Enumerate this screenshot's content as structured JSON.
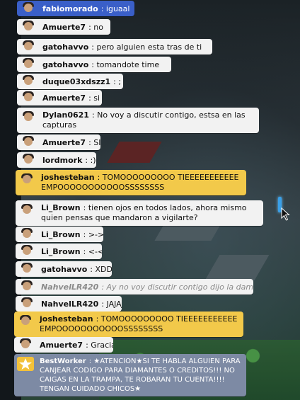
{
  "chat": {
    "messages": [
      {
        "name": "fabiomorado",
        "text": "iguaal",
        "style": "blue"
      },
      {
        "name": "Amuerte7",
        "text": "no",
        "style": "white"
      },
      {
        "name": "gatohavvo",
        "text": "pero alguien esta tras de ti",
        "style": "white"
      },
      {
        "name": "gatohavvo",
        "text": "tomandote time",
        "style": "white"
      },
      {
        "name": "duque03xdszz1",
        "text": ";",
        "style": "white"
      },
      {
        "name": "Amuerte7",
        "text": "si",
        "style": "white"
      },
      {
        "name": "Dylan0621",
        "text": "No voy a discutir contigo, estsa en las capturas",
        "style": "white"
      },
      {
        "name": "Amuerte7",
        "text": "SI",
        "style": "white"
      },
      {
        "name": "lordmork",
        "text": ":)",
        "style": "white"
      },
      {
        "name": "joshesteban",
        "text": "TOMOOOOOOOOO TIEEEEEEEEEEEEMPOOOOOOOOOOOSSSSSSSS",
        "style": "yellow"
      },
      {
        "name": "Li_Brown",
        "text": "tienen ojos en todos lados, ahora mismo quien pensas que mandaron a vigilarte?",
        "style": "white"
      },
      {
        "name": "Li_Brown",
        "text": ">->",
        "style": "white"
      },
      {
        "name": "Li_Brown",
        "text": "<-<",
        "style": "white"
      },
      {
        "name": "gatohavvo",
        "text": "XDD",
        "style": "white"
      },
      {
        "name": "NahvelLR420",
        "text": "Ay no voy discutir contigo dijo la dama",
        "style": "italic"
      },
      {
        "name": "NahvelLR420",
        "text": "JAJAJA",
        "style": "white"
      },
      {
        "name": "joshesteban",
        "text": "TOMOOOOOOOOO TIEEEEEEEEEEEEMPOOOOOOOOOOOSSSSSSSS",
        "style": "yellow"
      },
      {
        "name": "Amuerte7",
        "text": "Gracias",
        "style": "white"
      },
      {
        "name": "BestWorker",
        "text": "★ATENCION★SI TE HABLA ALGUIEN PARA CANJEAR CODIGO PARA DIAMANTES O CREDITOS!!! NO CAIGAS EN LA TRAMPA, TE ROBARAN TU CUENTA!!!! TENGAN CUIDADO CHICOS★",
        "style": "bot"
      }
    ]
  },
  "colors": {
    "bubble_white": "#f2f2f2",
    "bubble_blue": "#3a5fc8",
    "bubble_yellow": "#f2c94a",
    "bubble_bot": "#7d8aa4",
    "scrollbar_accent": "#3aa0e8"
  },
  "icons": {
    "avatar": "habbo-avatar-icon",
    "bot_badge": "star-badge-icon",
    "cursor": "mouse-pointer-icon"
  }
}
